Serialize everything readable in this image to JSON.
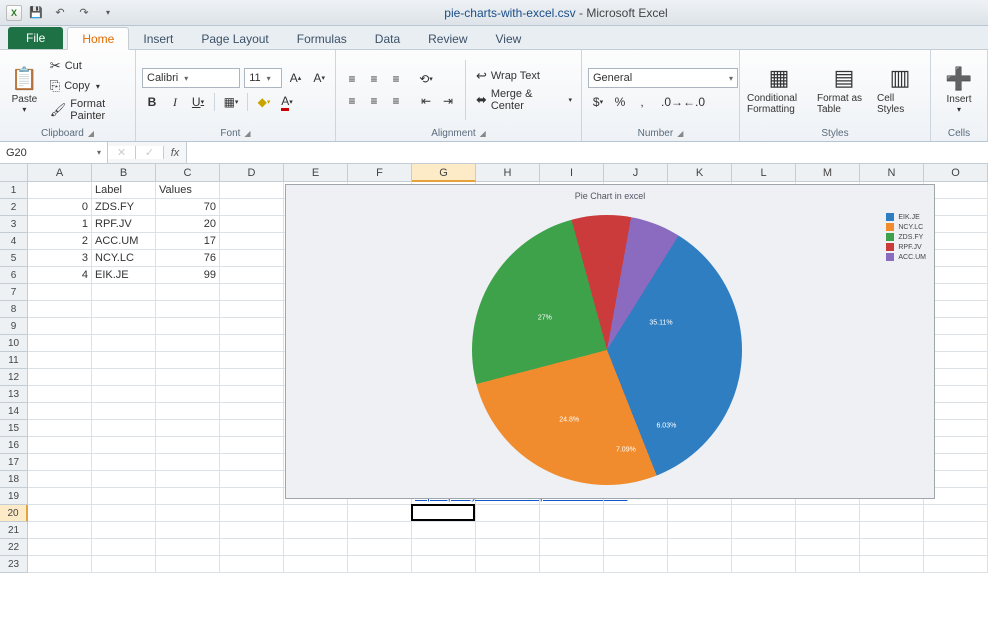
{
  "titlebar": {
    "filename": "pie-charts-with-excel.csv",
    "app": "Microsoft Excel"
  },
  "qat": {
    "save_tip": "Save",
    "undo_tip": "Undo",
    "redo_tip": "Redo"
  },
  "tabs": {
    "file": "File",
    "home": "Home",
    "insert": "Insert",
    "page_layout": "Page Layout",
    "formulas": "Formulas",
    "data": "Data",
    "review": "Review",
    "view": "View"
  },
  "clipboard": {
    "paste": "Paste",
    "cut": "Cut",
    "copy": "Copy",
    "format_painter": "Format Painter",
    "group": "Clipboard"
  },
  "font": {
    "name": "Calibri",
    "size": "11",
    "group": "Font"
  },
  "alignment": {
    "wrap": "Wrap Text",
    "merge": "Merge & Center",
    "group": "Alignment"
  },
  "number": {
    "format": "General",
    "group": "Number"
  },
  "styles": {
    "conditional": "Conditional Formatting",
    "table": "Format as Table",
    "cell": "Cell Styles",
    "group": "Styles"
  },
  "cells_group": {
    "insert": "Insert",
    "group": "Cells"
  },
  "name_box": "G20",
  "columns": [
    "A",
    "B",
    "C",
    "D",
    "E",
    "F",
    "G",
    "H",
    "I",
    "J",
    "K",
    "L",
    "M",
    "N",
    "O"
  ],
  "rows": 23,
  "headers": {
    "a": "",
    "b": "Label",
    "c": "Values"
  },
  "data_rows": [
    {
      "a": "0",
      "b": "ZDS.FY",
      "c": "70"
    },
    {
      "a": "1",
      "b": "RPF.JV",
      "c": "20"
    },
    {
      "a": "2",
      "b": "ACC.UM",
      "c": "17"
    },
    {
      "a": "3",
      "b": "NCY.LC",
      "c": "76"
    },
    {
      "a": "4",
      "b": "EIK.JE",
      "c": "99"
    }
  ],
  "link_cell": "https://plot.ly/~tarzzz/782/pie-chart-in-excel/",
  "chart_data": {
    "type": "pie",
    "title": "Pie Chart in excel",
    "series": [
      {
        "name": "EIK.JE",
        "value": 99,
        "pct": 35.11,
        "color": "#2f7ec1"
      },
      {
        "name": "NCY.LC",
        "value": 76,
        "pct": 26.95,
        "color": "#f08c2e"
      },
      {
        "name": "ZDS.FY",
        "value": 70,
        "pct": 24.82,
        "color": "#3da24a"
      },
      {
        "name": "RPF.JV",
        "value": 20,
        "pct": 7.09,
        "color": "#cb3b3b"
      },
      {
        "name": "ACC.UM",
        "value": 17,
        "pct": 6.03,
        "color": "#8a6bbf"
      }
    ],
    "legend_order": [
      "EIK.JE",
      "NCY.LC",
      "ZDS.FY",
      "RPF.JV",
      "ACC.UM"
    ],
    "labels": {
      "eik": "35.11%",
      "ncy": "27%",
      "zds": "24.8%",
      "rpf": "7.09%",
      "acc": "6.03%"
    }
  },
  "active": {
    "col": "G",
    "row": 20
  }
}
